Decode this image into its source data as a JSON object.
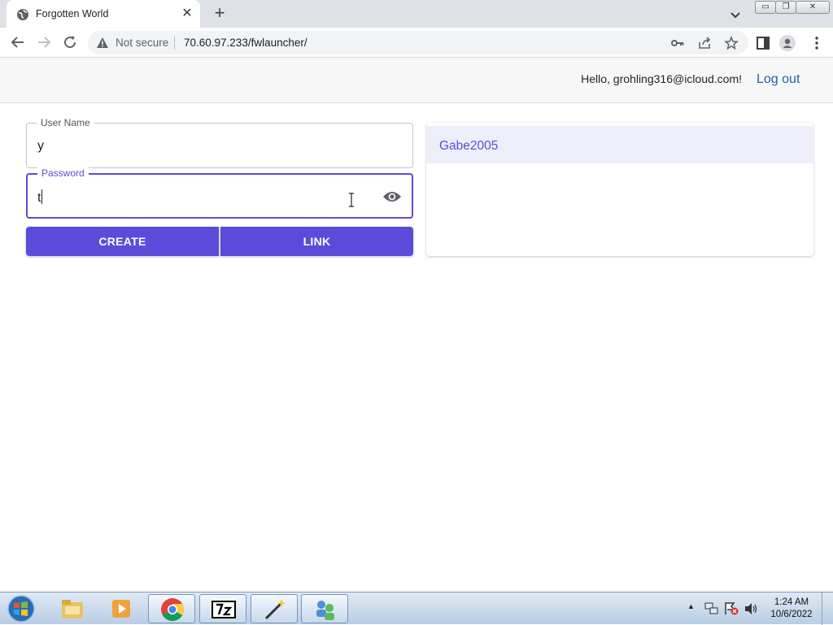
{
  "browser": {
    "tab_title": "Forgotten World",
    "tab_close": "✕",
    "new_tab": "+",
    "security_label": "Not secure",
    "url": "70.60.97.233/fwlauncher/",
    "window_controls": {
      "minimize": "▭",
      "maximize": "❐",
      "close": "✕"
    }
  },
  "header": {
    "greeting": "Hello, grohling316@icloud.com!",
    "logout_label": "Log out"
  },
  "form": {
    "username": {
      "label": "User Name",
      "value": "y"
    },
    "password": {
      "label": "Password",
      "value": "t"
    },
    "create_label": "CREATE",
    "link_label": "LINK"
  },
  "accounts": {
    "items": [
      {
        "name": "Gabe2005"
      }
    ]
  },
  "taskbar": {
    "time": "1:24 AM",
    "date": "10/6/2022",
    "apps": [
      "file-explorer",
      "media-player",
      "chrome",
      "7-zip",
      "magic-wand-app",
      "network-app"
    ]
  },
  "colors": {
    "accent": "#5b4bdb",
    "link": "#1f5fa8",
    "list_highlight": "#eeeefb"
  }
}
